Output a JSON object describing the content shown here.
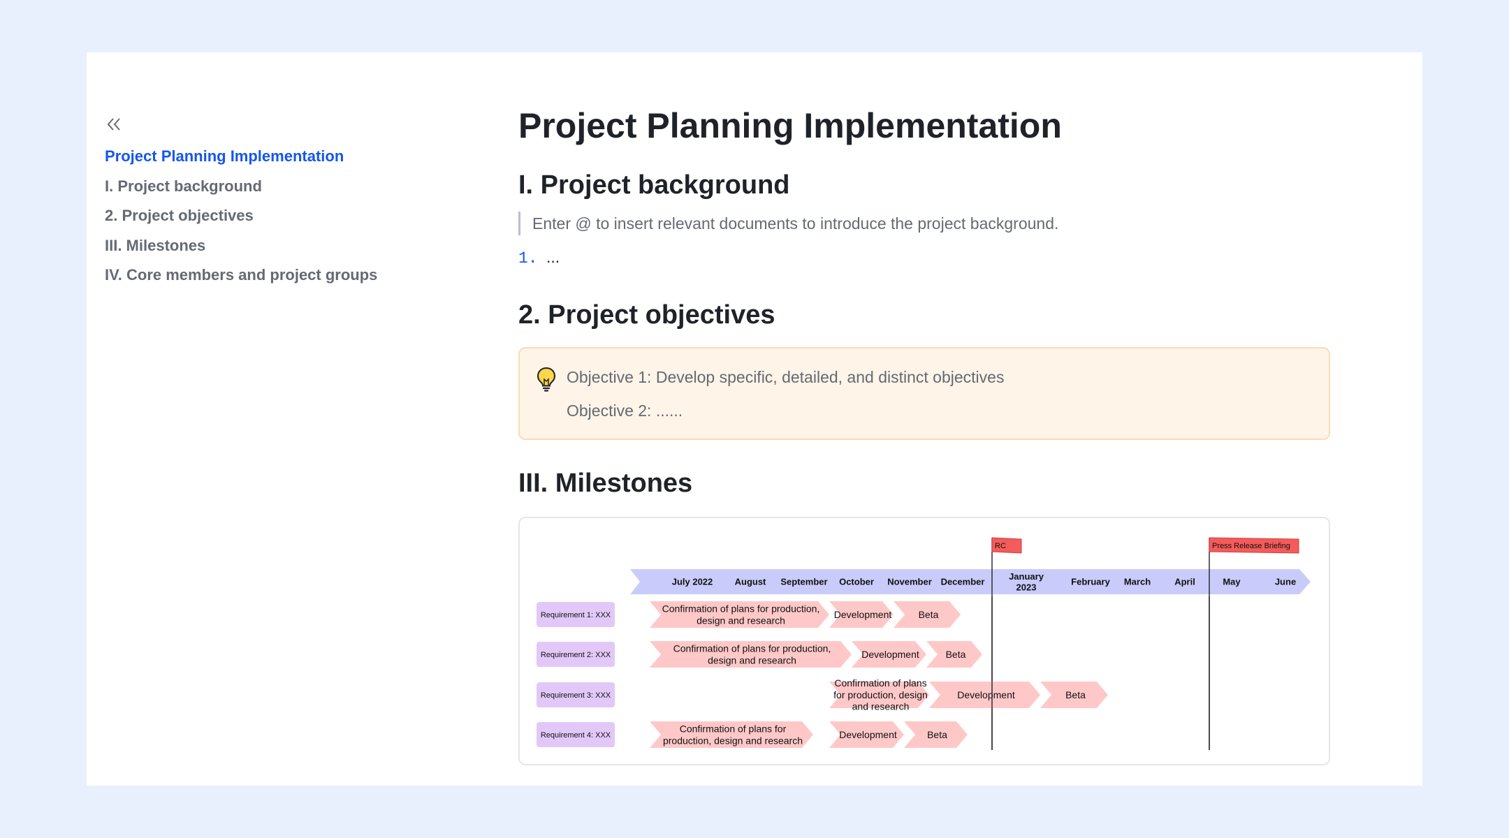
{
  "toc": {
    "collapse_icon": "double-chevron-left-icon",
    "items": [
      {
        "label": "Project Planning Implementation",
        "active": true
      },
      {
        "label": "I. Project background",
        "active": false
      },
      {
        "label": "2. Project objectives",
        "active": false
      },
      {
        "label": "III. Milestones",
        "active": false
      },
      {
        "label": "IV. Core members and project groups",
        "active": false
      }
    ]
  },
  "doc": {
    "title": "Project Planning Implementation",
    "background": {
      "heading": "I. Project background",
      "quote": "Enter @ to insert relevant documents to introduce the project background.",
      "list_number": "1.",
      "list_text": "..."
    },
    "objectives": {
      "heading": "2. Project objectives",
      "callout_icon": "lightbulb-icon",
      "line1": "Objective 1: Develop specific, detailed, and distinct objectives",
      "line2": "Objective 2: ......"
    },
    "milestones": {
      "heading": "III. Milestones",
      "timeline": {
        "months": [
          "July 2022",
          "August",
          "September",
          "October",
          "November",
          "December",
          "January\n2023",
          "February",
          "March",
          "April",
          "May",
          "June"
        ],
        "flags": [
          "RC",
          "Press Release Briefing"
        ],
        "requirements": [
          {
            "label": "Requirement 1: XXX",
            "phases": [
              "Confirmation of plans for production,\ndesign and research",
              "Development",
              "Beta"
            ]
          },
          {
            "label": "Requirement 2: XXX",
            "phases": [
              "Confirmation of plans for production,\ndesign and research",
              "Development",
              "Beta"
            ]
          },
          {
            "label": "Requirement 3: XXX",
            "phases": [
              "Confirmation of plans\nfor production, design\nand research",
              "Development",
              "Beta"
            ]
          },
          {
            "label": "Requirement 4: XXX",
            "phases": [
              "Confirmation of plans for\nproduction, design and research",
              "Development",
              "Beta"
            ]
          }
        ]
      }
    }
  },
  "colors": {
    "accent": "#1456f0",
    "timeline_band": "#c9ccfb",
    "requirement_label": "#e2c8f8",
    "phase": "#ffc8c8",
    "flag": "#f45b5b"
  }
}
